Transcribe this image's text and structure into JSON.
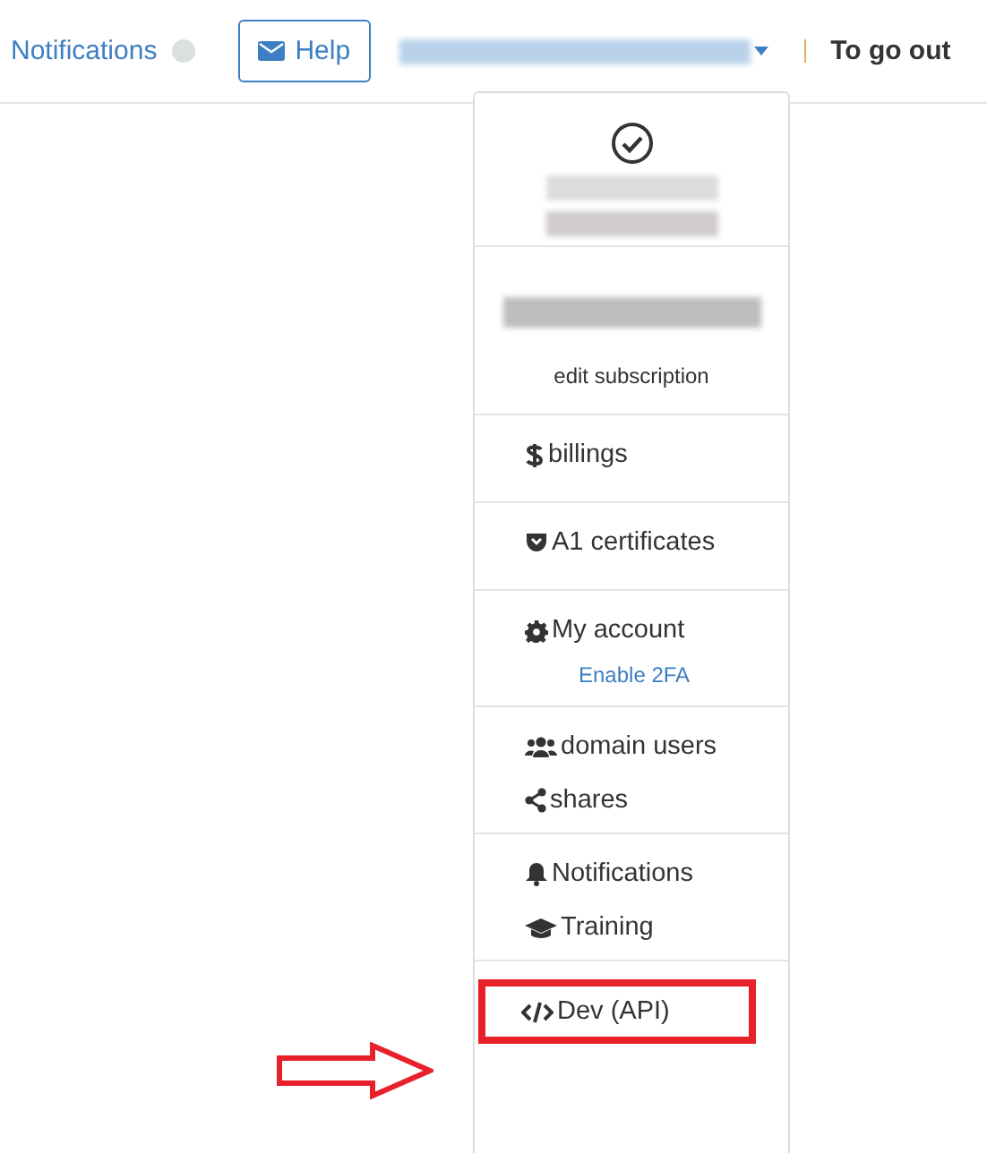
{
  "header": {
    "notifications": "Notifications",
    "help": "Help",
    "logout": "To go out"
  },
  "menu": {
    "top_caption": "edit subscription",
    "sections": [
      {
        "items": [
          {
            "label": "billings",
            "kind": "main"
          }
        ]
      },
      {
        "items": [
          {
            "label": "A1 certificates",
            "kind": "main"
          }
        ]
      },
      {
        "items": [
          {
            "label": "My account",
            "kind": "main"
          },
          {
            "label": "Enable 2FA",
            "kind": "sub"
          }
        ]
      },
      {
        "items": [
          {
            "label": "domain users",
            "kind": "main"
          },
          {
            "label": "shares",
            "kind": "main"
          }
        ]
      },
      {
        "items": [
          {
            "label": "Notifications",
            "kind": "main"
          },
          {
            "label": "Training",
            "kind": "main"
          }
        ]
      },
      {
        "items": [
          {
            "label": "Dev (API)",
            "kind": "main",
            "highlighted": true
          }
        ]
      }
    ]
  }
}
